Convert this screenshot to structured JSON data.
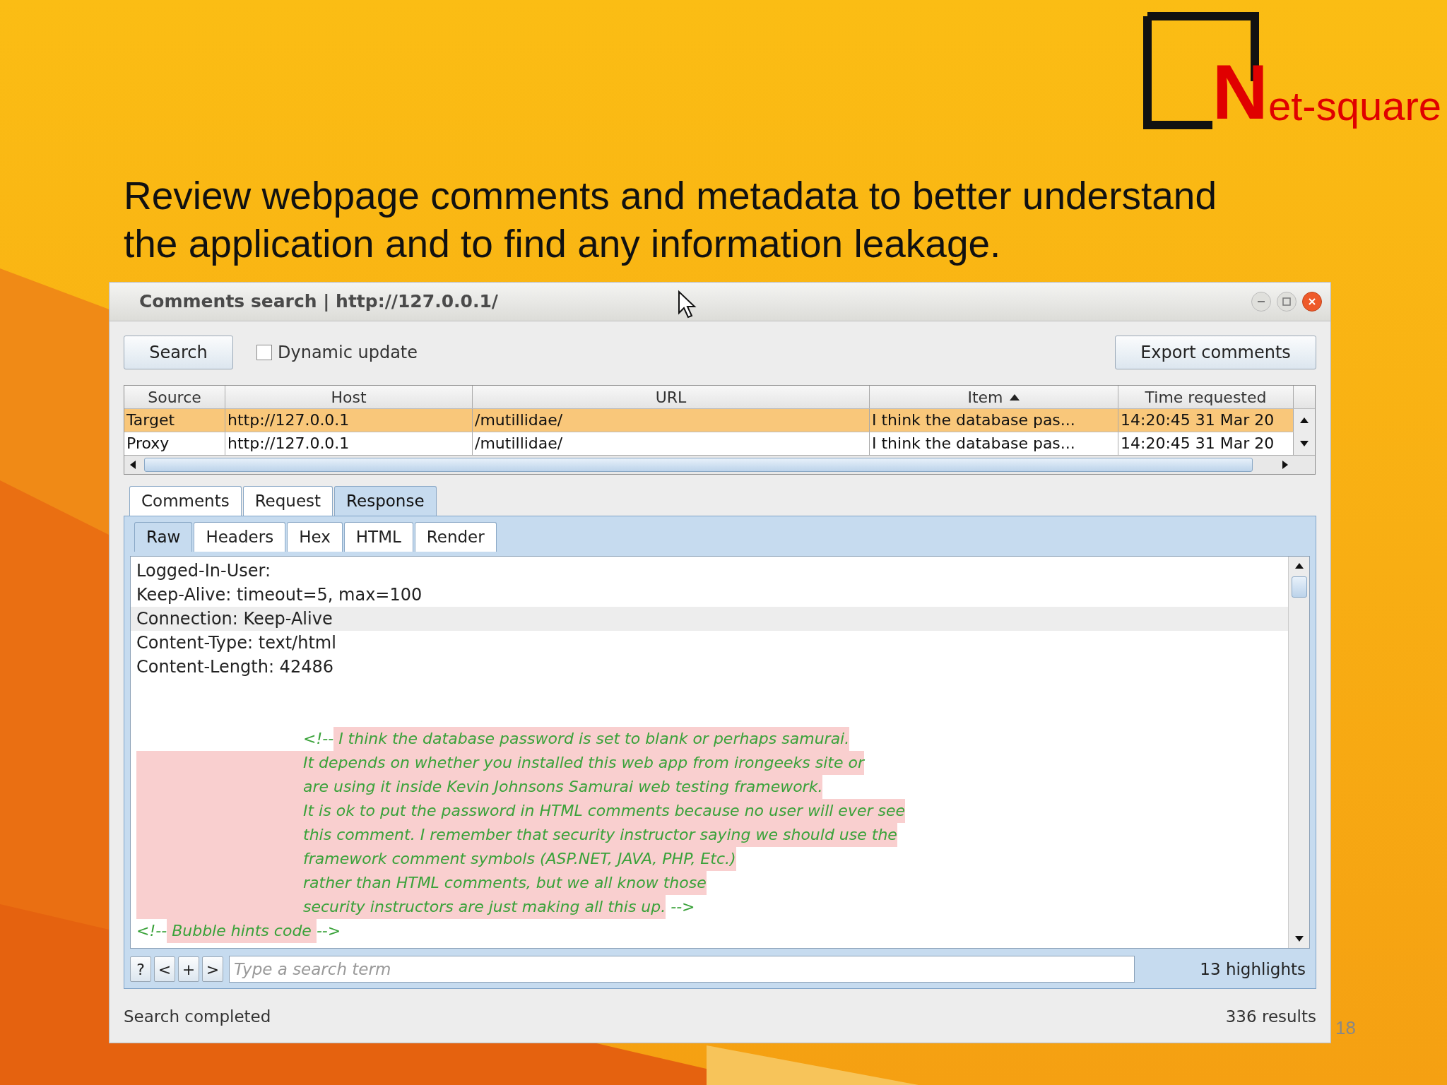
{
  "logo": {
    "initial": "N",
    "rest": "et-square"
  },
  "heading": "Review webpage comments and metadata to better understand the application and to find any information leakage.",
  "window": {
    "title": "Comments search | http://127.0.0.1/"
  },
  "toolbar": {
    "search_button": "Search",
    "dynamic_update": {
      "label": "Dynamic update",
      "checked": false
    },
    "export_button": "Export comments"
  },
  "table": {
    "columns": [
      {
        "label": "Source",
        "sorted": false
      },
      {
        "label": "Host",
        "sorted": false
      },
      {
        "label": "URL",
        "sorted": false
      },
      {
        "label": "Item",
        "sorted": true
      },
      {
        "label": "Time requested",
        "sorted": false
      }
    ],
    "rows": [
      {
        "selected": true,
        "cells": [
          "Target",
          "http://127.0.0.1",
          "/mutillidae/",
          "I think the database pas...",
          "14:20:45 31 Mar 20"
        ]
      },
      {
        "selected": false,
        "cells": [
          "Proxy",
          "http://127.0.0.1",
          "/mutillidae/",
          "I think the database pas...",
          "14:20:45 31 Mar 20"
        ]
      }
    ]
  },
  "tabs": [
    {
      "label": "Comments",
      "selected": false
    },
    {
      "label": "Request",
      "selected": false
    },
    {
      "label": "Response",
      "selected": true
    }
  ],
  "subtabs": [
    {
      "label": "Raw",
      "selected": true
    },
    {
      "label": "Headers",
      "selected": false
    },
    {
      "label": "Hex",
      "selected": false
    },
    {
      "label": "HTML",
      "selected": false
    },
    {
      "label": "Render",
      "selected": false
    }
  ],
  "lines": [
    {
      "kind": "plain",
      "text": "Logged-In-User:",
      "selected": false
    },
    {
      "kind": "plain",
      "text": "Keep-Alive: timeout=5, max=100",
      "selected": false
    },
    {
      "kind": "plain",
      "text": "Connection: Keep-Alive",
      "selected": true
    },
    {
      "kind": "plain",
      "text": "Content-Type: text/html",
      "selected": false
    },
    {
      "kind": "plain",
      "text": "Content-Length: 42486",
      "selected": false
    },
    {
      "kind": "blank"
    },
    {
      "kind": "blank"
    },
    {
      "kind": "comment",
      "indented": true,
      "tab_highlighted": false,
      "before": "<!--",
      "highlight": " I think the database password is set to blank or perhaps samurai."
    },
    {
      "kind": "comment",
      "indented": true,
      "tab_highlighted": true,
      "highlight": "It depends on whether you installed this web app from irongeeks site or"
    },
    {
      "kind": "comment",
      "indented": true,
      "tab_highlighted": true,
      "highlight": "are using it inside Kevin Johnsons Samurai web testing framework."
    },
    {
      "kind": "comment",
      "indented": true,
      "tab_highlighted": true,
      "highlight": "It is ok to put the password in HTML comments because no user will ever see"
    },
    {
      "kind": "comment",
      "indented": true,
      "tab_highlighted": true,
      "highlight": "this comment. I remember that security instructor saying we should use the"
    },
    {
      "kind": "comment",
      "indented": true,
      "tab_highlighted": true,
      "highlight": "framework comment symbols (ASP.NET, JAVA, PHP, Etc.)"
    },
    {
      "kind": "comment",
      "indented": true,
      "tab_highlighted": true,
      "highlight": "rather than HTML comments, but we all know those"
    },
    {
      "kind": "comment",
      "indented": true,
      "tab_highlighted": true,
      "highlight": "security instructors are just making all this up.",
      "after": " -->"
    },
    {
      "kind": "comment",
      "indented": false,
      "before": "<!--",
      "highlight": " Bubble hints code ",
      "after": "-->"
    }
  ],
  "search_bar": {
    "buttons": [
      "?",
      "<",
      "+",
      ">"
    ],
    "placeholder": "Type a search term",
    "highlights": "13 highlights"
  },
  "status_bar": {
    "message": "Search completed",
    "results": "336 results"
  },
  "page_number": "18"
}
